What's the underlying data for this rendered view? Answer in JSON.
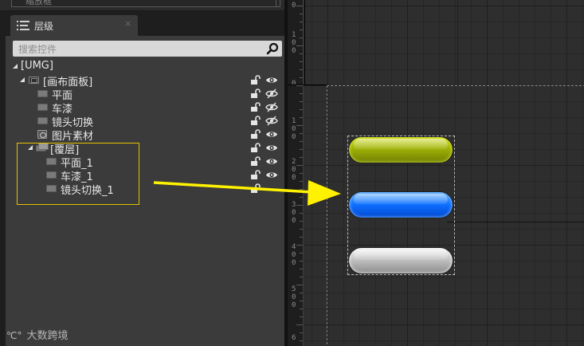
{
  "top_strip": {
    "partial_label": "缩放框"
  },
  "panel": {
    "tab_label": "层级",
    "tab_close": "×",
    "search_placeholder": "搜索控件"
  },
  "tree": {
    "root": "[UMG]",
    "canvas": "[画布面板]",
    "items_level2": [
      "平面",
      "车漆",
      "镜头切换",
      "图片素材"
    ],
    "overlay": "[覆层]",
    "items_level3": [
      "平面_1",
      "车漆_1",
      "镜头切换_1"
    ]
  },
  "ruler_labels": [
    {
      "text": "0"
    },
    {
      "text": "1"
    },
    {
      "text": "0"
    },
    {
      "text": "0"
    },
    {
      "text": "0"
    },
    {
      "text": "1"
    },
    {
      "text": "0"
    },
    {
      "text": "0"
    },
    {
      "text": "2"
    },
    {
      "text": "0"
    },
    {
      "text": "0"
    },
    {
      "text": "3"
    },
    {
      "text": "0"
    },
    {
      "text": "0"
    },
    {
      "text": "4"
    },
    {
      "text": "0"
    },
    {
      "text": "0"
    },
    {
      "text": "5"
    },
    {
      "text": "0"
    },
    {
      "text": "0"
    },
    {
      "text": "6"
    }
  ],
  "watermark": {
    "logo": "℃°",
    "text": "大数跨境"
  },
  "colors": {
    "selection_outline": "#e3c300",
    "annotation_arrow": "#fff200",
    "button_green": "#9aad06",
    "button_blue": "#0f6fff",
    "button_gray": "#bdbdbd"
  }
}
